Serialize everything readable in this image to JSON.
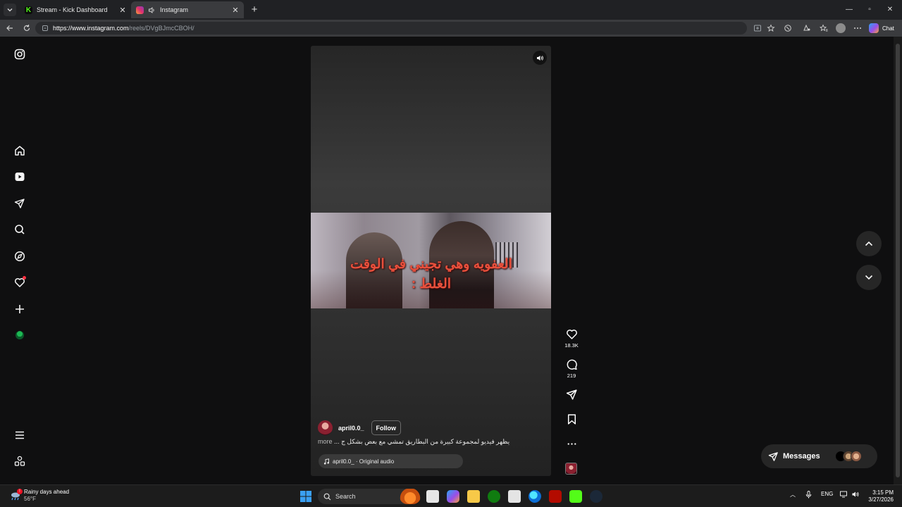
{
  "browser": {
    "tabs": [
      {
        "title": "Stream - Kick Dashboard",
        "active": false,
        "favicon_color": "#53fc18"
      },
      {
        "title": "Instagram",
        "active": true,
        "favicon_color": "#e1306c"
      }
    ],
    "url_scheme_host": "https://www.instagram.com",
    "url_path": "/reels/DVgBJmcCBOH/",
    "chat_label": "Chat"
  },
  "sidebar": {
    "items": [
      "instagram-logo-icon",
      "home-icon",
      "reels-icon",
      "direct-messages-icon",
      "search-icon",
      "explore-icon",
      "notifications-icon",
      "create-icon",
      "profile-icon"
    ],
    "bottom_items": [
      "more-menu-icon",
      "also-from-meta-icon"
    ],
    "notification_dot_color": "#ff3040"
  },
  "reel": {
    "video_caption": "العفويه وهي تجيني في الوقت الغلط :",
    "username": "april0.0_",
    "follow_label": "Follow",
    "description": "يظهر فيديو لمجموعة كبيرة من البطاريق تمشي مع بعض بشكل ج",
    "more_label": "more",
    "ellipsis": "...",
    "audio_label": "april0.0_ · Original audio"
  },
  "actions": {
    "likes": "18.3K",
    "comments": "219"
  },
  "messages": {
    "label": "Messages"
  },
  "taskbar": {
    "weather_title": "Rainy days ahead",
    "weather_temp": "56°F",
    "search_placeholder": "Search",
    "language": "ENG",
    "time": "3:15 PM",
    "date": "3/27/2026"
  },
  "colors": {
    "accent_red": "#ff3040",
    "page_bg": "#0f0f10",
    "caption_color": "#e8503c"
  }
}
